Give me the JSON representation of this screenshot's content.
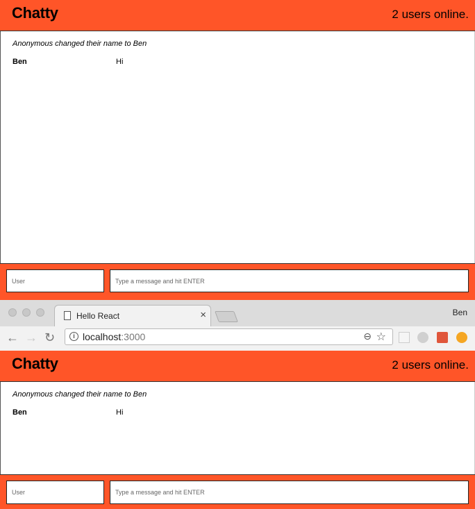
{
  "app_top": {
    "brand": "Chatty",
    "online": "2 users online.",
    "system_message": "Anonymous changed their name to Ben",
    "message": {
      "user": "Ben",
      "content": "Hi"
    },
    "user_placeholder": "User",
    "message_placeholder": "Type a message and hit ENTER"
  },
  "browser": {
    "tab_title": "Hello React",
    "tab_close": "×",
    "profile": "Ben",
    "url_host": "localhost",
    "url_port": ":3000",
    "icons": {
      "back": "back-arrow-icon",
      "forward": "forward-arrow-icon",
      "reload": "reload-icon",
      "info": "info-icon",
      "zoom": "zoom-out-icon",
      "bookmark": "star-icon"
    }
  },
  "app_bottom": {
    "brand": "Chatty",
    "online": "2 users online.",
    "system_message": "Anonymous changed their name to Ben",
    "message": {
      "user": "Ben",
      "content": "Hi"
    },
    "user_placeholder": "User",
    "message_placeholder": "Type a message and hit ENTER"
  },
  "colors": {
    "accent": "#ff5528",
    "chrome_bg": "#f2f2f2",
    "tabstrip_bg": "#dcdcdc"
  }
}
